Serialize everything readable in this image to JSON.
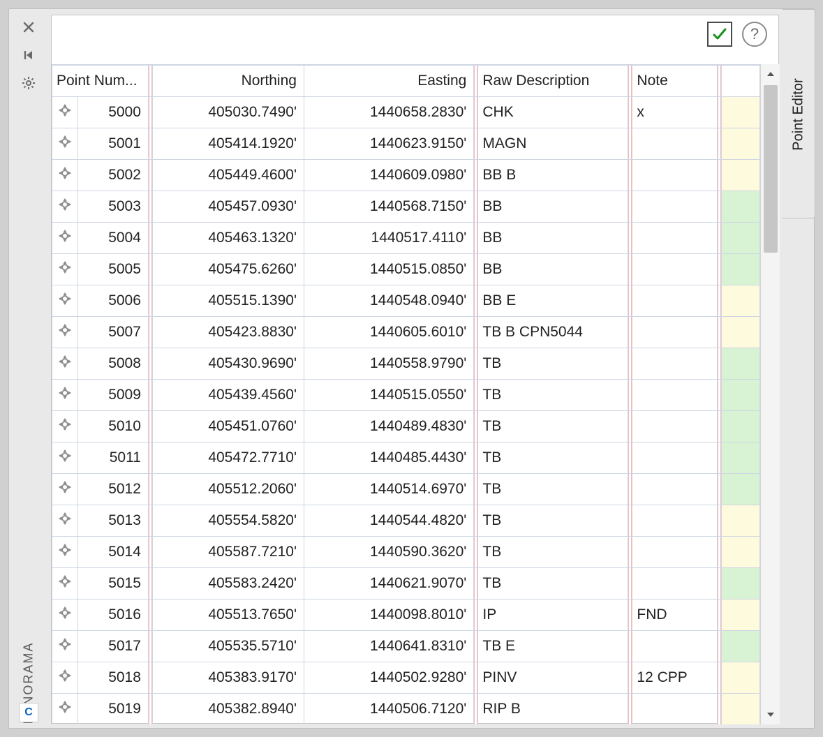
{
  "leftPanelLabel": "PANORAMA",
  "appBadge": "C",
  "rightTabLabel": "Point Editor",
  "helpSymbol": "?",
  "columns": {
    "pointNumber": "Point Num...",
    "northing": "Northing",
    "easting": "Easting",
    "rawDescription": "Raw Description",
    "note": "Note"
  },
  "rows": [
    {
      "pn": "5000",
      "northing": "405030.7490'",
      "easting": "1440658.2830'",
      "desc": "CHK",
      "note": "x",
      "status": "yellow"
    },
    {
      "pn": "5001",
      "northing": "405414.1920'",
      "easting": "1440623.9150'",
      "desc": "MAGN",
      "note": "",
      "status": "yellow"
    },
    {
      "pn": "5002",
      "northing": "405449.4600'",
      "easting": "1440609.0980'",
      "desc": "BB B",
      "note": "",
      "status": "yellow"
    },
    {
      "pn": "5003",
      "northing": "405457.0930'",
      "easting": "1440568.7150'",
      "desc": "BB",
      "note": "",
      "status": "green"
    },
    {
      "pn": "5004",
      "northing": "405463.1320'",
      "easting": "1440517.4110'",
      "desc": "BB",
      "note": "",
      "status": "green"
    },
    {
      "pn": "5005",
      "northing": "405475.6260'",
      "easting": "1440515.0850'",
      "desc": "BB",
      "note": "",
      "status": "green"
    },
    {
      "pn": "5006",
      "northing": "405515.1390'",
      "easting": "1440548.0940'",
      "desc": "BB E",
      "note": "",
      "status": "yellow"
    },
    {
      "pn": "5007",
      "northing": "405423.8830'",
      "easting": "1440605.6010'",
      "desc": "TB B CPN5044",
      "note": "",
      "status": "yellow"
    },
    {
      "pn": "5008",
      "northing": "405430.9690'",
      "easting": "1440558.9790'",
      "desc": "TB",
      "note": "",
      "status": "green"
    },
    {
      "pn": "5009",
      "northing": "405439.4560'",
      "easting": "1440515.0550'",
      "desc": "TB",
      "note": "",
      "status": "green"
    },
    {
      "pn": "5010",
      "northing": "405451.0760'",
      "easting": "1440489.4830'",
      "desc": "TB",
      "note": "",
      "status": "green"
    },
    {
      "pn": "5011",
      "northing": "405472.7710'",
      "easting": "1440485.4430'",
      "desc": "TB",
      "note": "",
      "status": "green"
    },
    {
      "pn": "5012",
      "northing": "405512.2060'",
      "easting": "1440514.6970'",
      "desc": "TB",
      "note": "",
      "status": "green"
    },
    {
      "pn": "5013",
      "northing": "405554.5820'",
      "easting": "1440544.4820'",
      "desc": "TB",
      "note": "",
      "status": "yellow"
    },
    {
      "pn": "5014",
      "northing": "405587.7210'",
      "easting": "1440590.3620'",
      "desc": "TB",
      "note": "",
      "status": "yellow"
    },
    {
      "pn": "5015",
      "northing": "405583.2420'",
      "easting": "1440621.9070'",
      "desc": "TB",
      "note": "",
      "status": "green"
    },
    {
      "pn": "5016",
      "northing": "405513.7650'",
      "easting": "1440098.8010'",
      "desc": "IP",
      "note": "FND",
      "status": "yellow"
    },
    {
      "pn": "5017",
      "northing": "405535.5710'",
      "easting": "1440641.8310'",
      "desc": "TB E",
      "note": "",
      "status": "green"
    },
    {
      "pn": "5018",
      "northing": "405383.9170'",
      "easting": "1440502.9280'",
      "desc": "PINV",
      "note": "12 CPP",
      "status": "yellow"
    },
    {
      "pn": "5019",
      "northing": "405382.8940'",
      "easting": "1440506.7120'",
      "desc": "RIP B",
      "note": "",
      "status": "yellow"
    }
  ]
}
